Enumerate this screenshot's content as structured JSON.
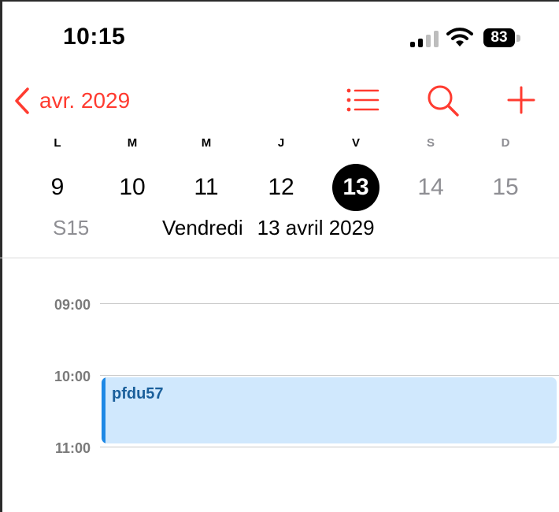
{
  "status_bar": {
    "time": "10:15",
    "battery": "83"
  },
  "nav": {
    "back_label": "avr. 2029"
  },
  "week": {
    "weekdays": [
      "L",
      "M",
      "M",
      "J",
      "V",
      "S",
      "D"
    ],
    "days": [
      "9",
      "10",
      "11",
      "12",
      "13",
      "14",
      "15"
    ],
    "selected_day": "13",
    "week_number": "S15",
    "selected_weekday_full": "Vendredi",
    "selected_date_full": "13 avril 2029"
  },
  "timeline": {
    "hours": [
      "09:00",
      "10:00",
      "11:00"
    ]
  },
  "events": [
    {
      "title": "pfdu57",
      "start": "10:00",
      "end": "11:00"
    }
  ],
  "icons": [
    "chevron-left-icon",
    "list-icon",
    "search-icon",
    "plus-icon",
    "signal-icon",
    "wifi-icon",
    "battery-icon"
  ],
  "colors": {
    "accent": "#ff3b30",
    "event_bg": "#d0e8fd",
    "event_bar": "#1e88e5",
    "event_text": "#1a5f9b",
    "weekend_text": "#8e8e93"
  }
}
